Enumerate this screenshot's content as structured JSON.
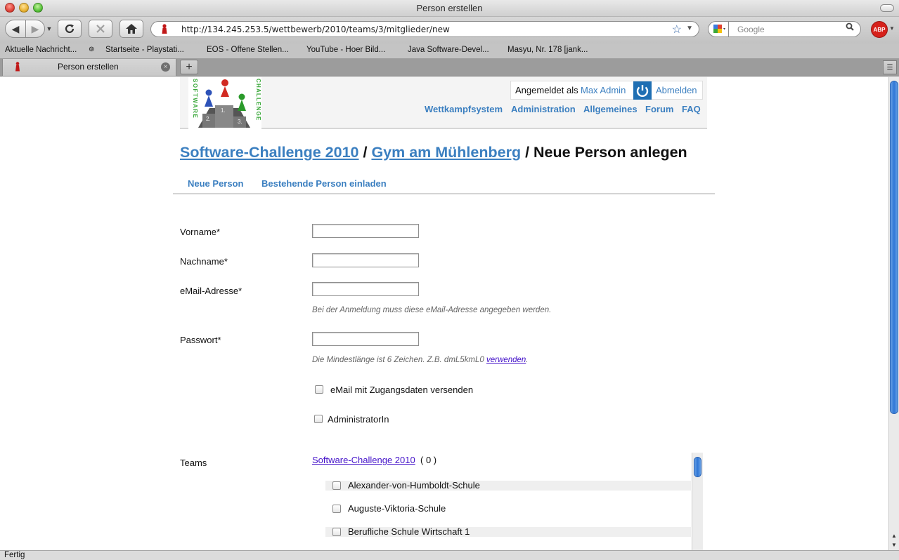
{
  "window": {
    "title": "Person erstellen"
  },
  "toolbar": {
    "url": "http://134.245.253.5/wettbewerb/2010/teams/3/mitglieder/new",
    "search_placeholder": "Google",
    "adblock_label": "ABP"
  },
  "bookmarks": [
    "Aktuelle Nachricht...",
    "Startseite - Playstati...",
    "EOS - Offene Stellen...",
    "YouTube - Hoer Bild...",
    "Java Software-Devel...",
    "Masyu, Nr. 178 [jank..."
  ],
  "tabs": [
    {
      "label": "Person erstellen",
      "active": true
    }
  ],
  "status": {
    "text": "Fertig"
  },
  "page": {
    "userbox": {
      "logged_in_as": "Angemeldet als",
      "user_name": "Max Admin",
      "logout": "Abmelden"
    },
    "topnav": [
      "Wettkampfsystem",
      "Administration",
      "Allgemeines",
      "Forum",
      "FAQ"
    ],
    "breadcrumb": {
      "contest": "Software-Challenge 2010",
      "sep1": " / ",
      "team": "Gym am Mühlenberg",
      "sep2": " / ",
      "current": "Neue Person anlegen"
    },
    "subtabs": [
      "Neue Person",
      "Bestehende Person einladen"
    ],
    "form": {
      "first_name": {
        "label": "Vorname*",
        "value": ""
      },
      "last_name": {
        "label": "Nachname*",
        "value": ""
      },
      "email": {
        "label": "eMail-Adresse*",
        "value": "",
        "hint": "Bei der Anmeldung muss diese eMail-Adresse angegeben werden."
      },
      "password": {
        "label": "Passwort*",
        "value": "",
        "hint_prefix": "Die Mindestlänge ist 6 Zeichen. Z.B. dmL5kmL0 ",
        "hint_link": "verwenden",
        "hint_suffix": "."
      },
      "send_mail": {
        "label": "eMail mit Zugangsdaten versenden",
        "checked": false
      },
      "admin": {
        "label": "AdministratorIn",
        "checked": false
      },
      "teams": {
        "label": "Teams",
        "contest_link": "Software-Challenge 2010",
        "contest_count": "( 0 )",
        "items": [
          {
            "name": "Alexander-von-Humboldt-Schule",
            "checked": false
          },
          {
            "name": "Auguste-Viktoria-Schule",
            "checked": false
          },
          {
            "name": "Berufliche Schule Wirtschaft 1",
            "checked": false
          }
        ]
      }
    }
  },
  "colors": {
    "link": "#3b7fc0",
    "visited_link": "#4412c9",
    "logo_text": "#3aa83a",
    "power_button": "#1f6fb3"
  }
}
